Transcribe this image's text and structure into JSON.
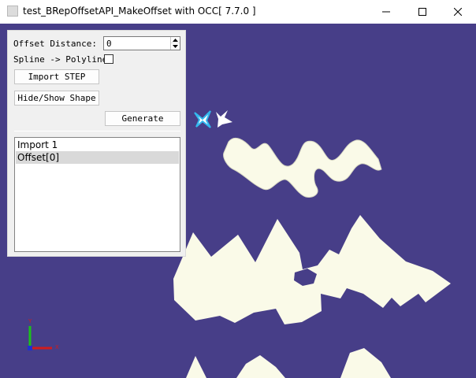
{
  "window": {
    "title": "test_BRepOffsetAPI_MakeOffset with OCC[ 7.7.0 ]",
    "icon": "application-icon",
    "controls": [
      "minimize-icon",
      "maximize-icon",
      "close-icon"
    ]
  },
  "panel": {
    "offset_label": "Offset Distance:",
    "offset_value": "0",
    "spline_label": "Spline -> Polyline",
    "spline_checked": false,
    "import_button": "Import STEP",
    "hide_show_button": "Hide/Show Shape",
    "generate_button": "Generate"
  },
  "shape_list": {
    "items": [
      "Import 1",
      "Offset[0]"
    ],
    "selected_index": 1
  },
  "viewer": {
    "background_color": "#473e88",
    "shape_color": "#fafae8",
    "axis_triad": [
      "x-axis",
      "y-axis",
      "z-axis"
    ]
  }
}
